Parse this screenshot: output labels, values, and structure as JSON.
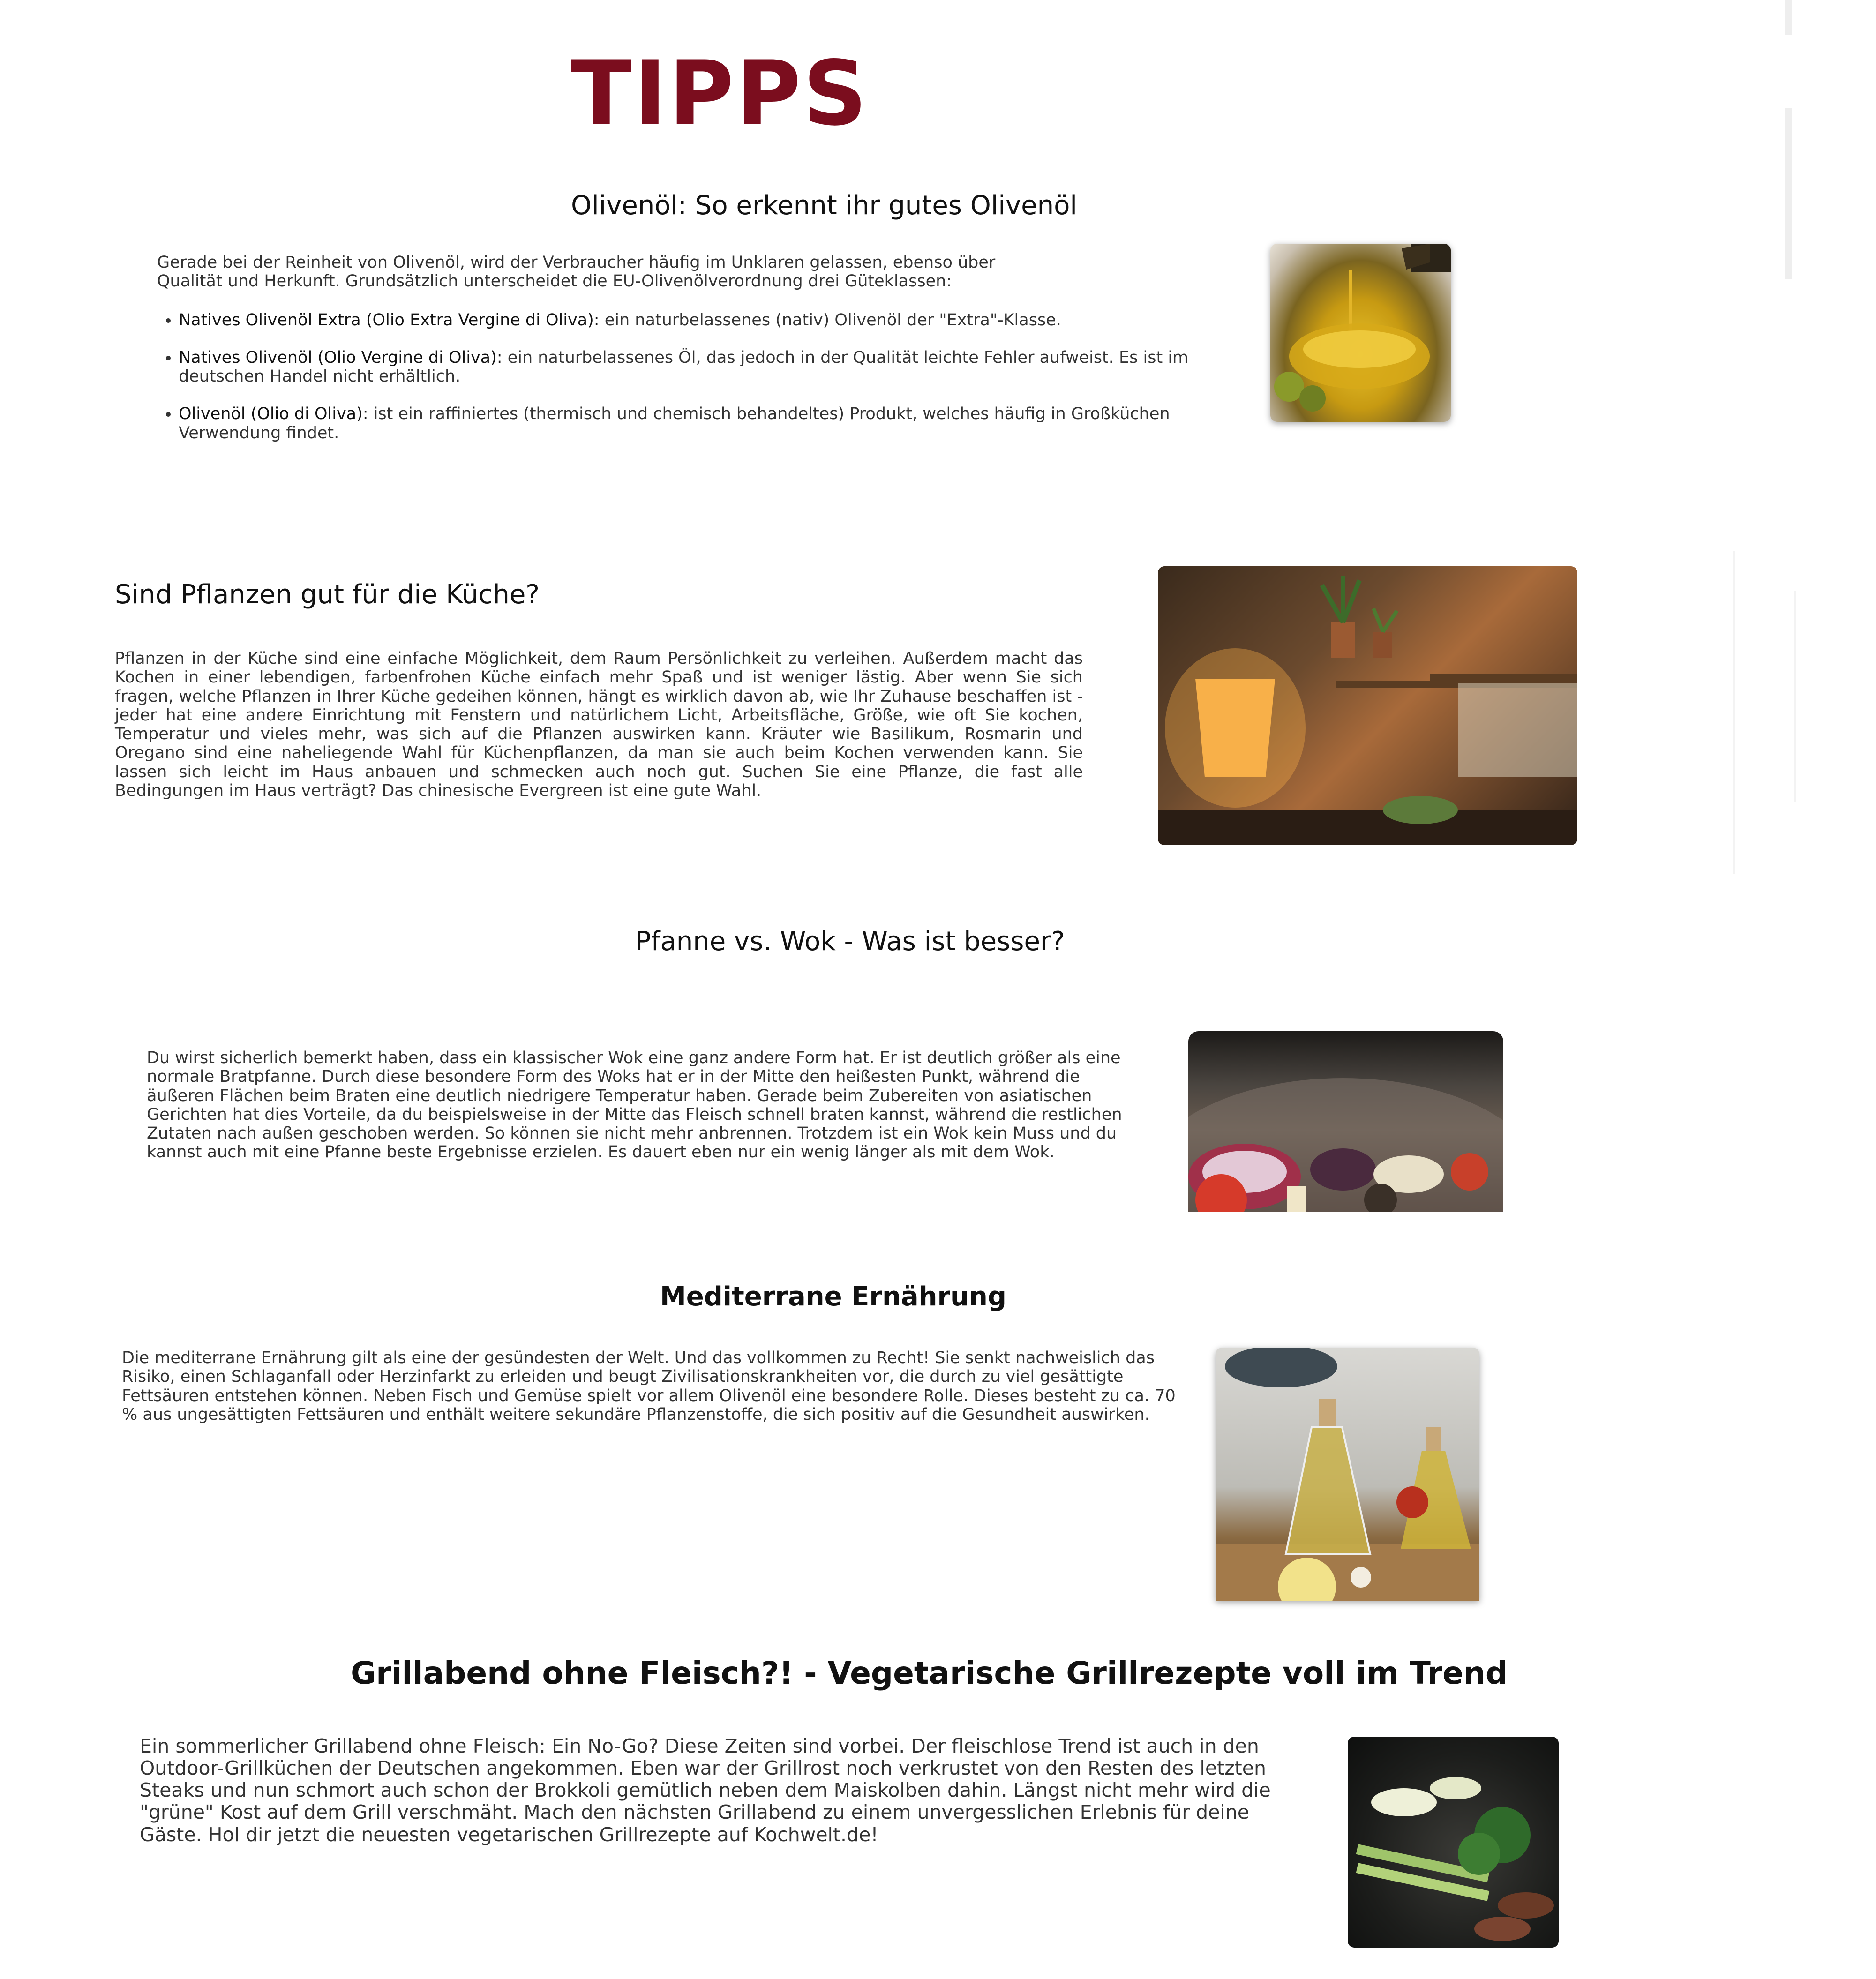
{
  "page_title": "TIPPS",
  "sections": [
    {
      "heading": "Olivenöl: So erkennt ihr gutes Olivenöl",
      "intro": "Gerade bei der Reinheit von Olivenöl, wird der Verbraucher häufig im Unklaren gelassen, ebenso über Qualität und Herkunft. Grundsätzlich unterscheidet die EU-Olivenölverordnung drei Güteklassen:",
      "items": [
        {
          "term": "Natives Olivenöl Extra (Olio Extra Vergine di Oliva):",
          "text": " ein naturbelassenes (nativ) Olivenöl der \"Extra\"-Klasse."
        },
        {
          "term": "Natives Olivenöl (Olio Vergine di Oliva):",
          "text": " ein naturbelassenes Öl, das jedoch in der Qualität leichte Fehler aufweist. Es ist im deutschen Handel nicht erhältlich."
        },
        {
          "term": "Olivenöl (Olio di Oliva):",
          "text": " ist ein raffiniertes (thermisch und chemisch behandeltes) Produkt, welches häufig in Großküchen Verwendung findet."
        }
      ],
      "image": "olive-oil-bowl-image"
    },
    {
      "heading": "Sind Pflanzen gut für die Küche?",
      "body": "Pflanzen in der Küche sind eine einfache Möglichkeit, dem Raum Persönlichkeit zu verleihen. Außerdem macht das Kochen in einer lebendigen, farbenfrohen Küche einfach mehr Spaß und ist weniger lästig. Aber wenn Sie sich fragen, welche Pflanzen in Ihrer Küche gedeihen können, hängt es wirklich davon ab, wie Ihr Zuhause beschaffen ist - jeder hat eine andere Einrichtung mit Fenstern und natürlichem Licht, Arbeitsfläche, Größe, wie oft Sie kochen, Temperatur und vieles mehr, was sich auf die Pflanzen auswirken kann. Kräuter wie Basilikum, Rosmarin und Oregano sind eine naheliegende Wahl für Küchenpflanzen, da man sie auch beim Kochen verwenden kann. Sie lassen sich leicht im Haus anbauen und schmecken auch noch gut. Suchen Sie eine Pflanze, die fast alle Bedingungen im Haus verträgt? Das chinesische Evergreen ist eine gute Wahl.",
      "image": "kitchen-plants-image"
    },
    {
      "heading": "Pfanne vs. Wok - Was ist besser?",
      "body": "Du wirst sicherlich bemerkt haben, dass ein klassischer Wok eine ganz andere Form hat. Er ist deutlich größer als eine normale Bratpfanne. Durch diese besondere Form des Woks hat er in der Mitte den heißesten Punkt, während die äußeren Flächen beim Braten eine deutlich niedrigere Temperatur haben. Gerade beim Zubereiten von asiatischen Gerichten hat dies Vorteile, da du beispielsweise in der Mitte das Fleisch schnell braten kannst, während die restlichen Zutaten nach außen geschoben werden. So können sie nicht mehr anbrennen. Trotzdem ist ein Wok kein Muss und du kannst auch mit eine Pfanne beste Ergebnisse erzielen. Es dauert eben nur ein wenig länger als mit dem Wok.",
      "image": "wok-vegetables-image"
    },
    {
      "heading": "Mediterrane Ernährung",
      "body": "Die mediterrane Ernährung gilt als eine der gesündesten der Welt. Und das vollkommen zu Recht! Sie senkt nachweislich das Risiko, einen Schlaganfall oder Herzinfarkt zu erleiden und beugt Zivilisationskrankheiten vor, die durch zu viel gesättigte Fettsäuren entstehen können. Neben Fisch und Gemüse spielt vor allem Olivenöl eine besondere Rolle. Dieses besteht zu ca. 70 % aus ungesättigten Fettsäuren und enthält weitere sekundäre Pflanzenstoffe, die sich positiv auf die Gesundheit auswirken.",
      "image": "oil-bottles-image"
    },
    {
      "heading": "Grillabend ohne Fleisch?! - Vegetarische Grillrezepte voll im Trend",
      "body": "Ein sommerlicher Grillabend ohne Fleisch: Ein No-Go? Diese Zeiten sind vorbei. Der fleischlose Trend ist auch in den Outdoor-Grillküchen der Deutschen angekommen. Eben war der Grillrost noch verkrustet von den Resten des letzten Steaks und nun schmort auch schon der Brokkoli gemütlich neben dem Maiskolben dahin. Längst nicht mehr wird die \"grüne\" Kost auf dem Grill verschmäht. Mach den nächsten Grillabend zu einem unvergesslichen Erlebnis für deine Gäste. Hol dir jetzt die neuesten vegetarischen Grillrezepte auf Kochwelt.de!",
      "image": "vegetable-grill-image"
    }
  ],
  "colors": {
    "title": "#7b0d1e",
    "heading": "#111111",
    "text": "#333333",
    "background": "#ffffff"
  }
}
